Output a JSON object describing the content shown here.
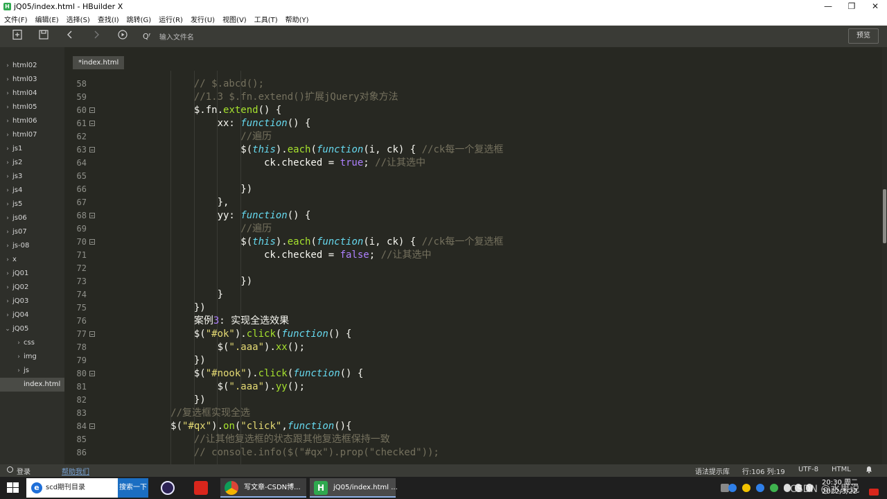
{
  "window": {
    "title": "jQ05/index.html - HBuilder X",
    "app_icon_letter": "H",
    "controls": {
      "minimize": "—",
      "maximize": "❐",
      "close": "✕"
    }
  },
  "menu": [
    "文件(F)",
    "编辑(E)",
    "选择(S)",
    "查找(I)",
    "跳转(G)",
    "运行(R)",
    "发行(U)",
    "视图(V)",
    "工具(T)",
    "帮助(Y)"
  ],
  "toolbar": {
    "new_icon": "new-file-icon",
    "save_icon": "save-icon",
    "back_icon": "back-icon",
    "forward_icon": "forward-icon",
    "run_icon": "run-icon",
    "search_glyph": "Qᶠ",
    "search_placeholder": "输入文件名",
    "preview_label": "预览"
  },
  "sidebar": {
    "items": [
      {
        "label": "html02",
        "arrow": "›"
      },
      {
        "label": "html03",
        "arrow": "›"
      },
      {
        "label": "html04",
        "arrow": "›"
      },
      {
        "label": "html05",
        "arrow": "›"
      },
      {
        "label": "html06",
        "arrow": "›"
      },
      {
        "label": "html07",
        "arrow": "›"
      },
      {
        "label": "js1",
        "arrow": "›"
      },
      {
        "label": "js2",
        "arrow": "›"
      },
      {
        "label": "js3",
        "arrow": "›"
      },
      {
        "label": "js4",
        "arrow": "›"
      },
      {
        "label": "js5",
        "arrow": "›"
      },
      {
        "label": "js06",
        "arrow": "›"
      },
      {
        "label": "js07",
        "arrow": "›"
      },
      {
        "label": "js-08",
        "arrow": "›"
      },
      {
        "label": "x",
        "arrow": "›"
      },
      {
        "label": "jQ01",
        "arrow": "›"
      },
      {
        "label": "jQ02",
        "arrow": "›"
      },
      {
        "label": "jQ03",
        "arrow": "›"
      },
      {
        "label": "jQ04",
        "arrow": "›"
      },
      {
        "label": "jQ05",
        "arrow": "⌄"
      },
      {
        "label": "css",
        "arrow": "›",
        "child": true
      },
      {
        "label": "img",
        "arrow": "›",
        "child": true
      },
      {
        "label": "js",
        "arrow": "›",
        "child": true
      },
      {
        "label": "index.html",
        "arrow": "",
        "child": true,
        "active": true
      }
    ]
  },
  "tab": {
    "label": "*index.html"
  },
  "editor": {
    "lines": [
      {
        "n": "58",
        "fold": false,
        "tokens": [
          [
            "cmt",
            "                // $.abcd();"
          ]
        ]
      },
      {
        "n": "59",
        "fold": false,
        "tokens": [
          [
            "cmt",
            "                //1.3 $.fn.extend()扩展jQuery对象方法"
          ]
        ]
      },
      {
        "n": "60",
        "fold": true,
        "tokens": [
          [
            "def",
            "                $.fn."
          ],
          [
            "fn",
            "extend"
          ],
          [
            "def",
            "() {"
          ]
        ]
      },
      {
        "n": "61",
        "fold": true,
        "tokens": [
          [
            "def",
            "                    xx: "
          ],
          [
            "kw",
            "function"
          ],
          [
            "def",
            "() {"
          ]
        ]
      },
      {
        "n": "62",
        "fold": false,
        "tokens": [
          [
            "cmt",
            "                        //遍历"
          ]
        ]
      },
      {
        "n": "63",
        "fold": true,
        "tokens": [
          [
            "def",
            "                        $("
          ],
          [
            "kw",
            "this"
          ],
          [
            "def",
            ")."
          ],
          [
            "fn",
            "each"
          ],
          [
            "def",
            "("
          ],
          [
            "kw",
            "function"
          ],
          [
            "def",
            "(i, ck) { "
          ],
          [
            "cmt",
            "//ck每一个复选框"
          ]
        ]
      },
      {
        "n": "64",
        "fold": false,
        "tokens": [
          [
            "def",
            "                            ck.checked = "
          ],
          [
            "bool",
            "true"
          ],
          [
            "def",
            "; "
          ],
          [
            "cmt",
            "//让其选中"
          ]
        ]
      },
      {
        "n": "65",
        "fold": false,
        "tokens": [
          [
            "def",
            ""
          ]
        ]
      },
      {
        "n": "66",
        "fold": false,
        "tokens": [
          [
            "def",
            "                        })"
          ]
        ]
      },
      {
        "n": "67",
        "fold": false,
        "tokens": [
          [
            "def",
            "                    },"
          ]
        ]
      },
      {
        "n": "68",
        "fold": true,
        "tokens": [
          [
            "def",
            "                    yy: "
          ],
          [
            "kw",
            "function"
          ],
          [
            "def",
            "() {"
          ]
        ]
      },
      {
        "n": "69",
        "fold": false,
        "tokens": [
          [
            "cmt",
            "                        //遍历"
          ]
        ]
      },
      {
        "n": "70",
        "fold": true,
        "tokens": [
          [
            "def",
            "                        $("
          ],
          [
            "kw",
            "this"
          ],
          [
            "def",
            ")."
          ],
          [
            "fn",
            "each"
          ],
          [
            "def",
            "("
          ],
          [
            "kw",
            "function"
          ],
          [
            "def",
            "(i, ck) { "
          ],
          [
            "cmt",
            "//ck每一个复选框"
          ]
        ]
      },
      {
        "n": "71",
        "fold": false,
        "tokens": [
          [
            "def",
            "                            ck.checked = "
          ],
          [
            "bool",
            "false"
          ],
          [
            "def",
            "; "
          ],
          [
            "cmt",
            "//让其选中"
          ]
        ]
      },
      {
        "n": "72",
        "fold": false,
        "mark": true,
        "tokens": [
          [
            "def",
            ""
          ]
        ]
      },
      {
        "n": "73",
        "fold": false,
        "tokens": [
          [
            "def",
            "                        })"
          ]
        ]
      },
      {
        "n": "74",
        "fold": false,
        "tokens": [
          [
            "def",
            "                    }"
          ]
        ]
      },
      {
        "n": "75",
        "fold": false,
        "tokens": [
          [
            "def",
            "                })"
          ]
        ]
      },
      {
        "n": "76",
        "fold": false,
        "tokens": [
          [
            "def",
            "                案例"
          ],
          [
            "num",
            "3"
          ],
          [
            "def",
            ": 实现全选效果"
          ]
        ]
      },
      {
        "n": "77",
        "fold": true,
        "tokens": [
          [
            "def",
            "                $("
          ],
          [
            "str",
            "\"#ok\""
          ],
          [
            "def",
            ")."
          ],
          [
            "fn",
            "click"
          ],
          [
            "def",
            "("
          ],
          [
            "kw",
            "function"
          ],
          [
            "def",
            "() {"
          ]
        ]
      },
      {
        "n": "78",
        "fold": false,
        "tokens": [
          [
            "def",
            "                    $("
          ],
          [
            "str",
            "\".aaa\""
          ],
          [
            "def",
            ")."
          ],
          [
            "fn",
            "xx"
          ],
          [
            "def",
            "();"
          ]
        ]
      },
      {
        "n": "79",
        "fold": false,
        "tokens": [
          [
            "def",
            "                })"
          ]
        ]
      },
      {
        "n": "80",
        "fold": true,
        "tokens": [
          [
            "def",
            "                $("
          ],
          [
            "str",
            "\"#nook\""
          ],
          [
            "def",
            ")."
          ],
          [
            "fn",
            "click"
          ],
          [
            "def",
            "("
          ],
          [
            "kw",
            "function"
          ],
          [
            "def",
            "() {"
          ]
        ]
      },
      {
        "n": "81",
        "fold": false,
        "tokens": [
          [
            "def",
            "                    $("
          ],
          [
            "str",
            "\".aaa\""
          ],
          [
            "def",
            ")."
          ],
          [
            "fn",
            "yy"
          ],
          [
            "def",
            "();"
          ]
        ]
      },
      {
        "n": "82",
        "fold": false,
        "tokens": [
          [
            "def",
            "                })"
          ]
        ]
      },
      {
        "n": "83",
        "fold": false,
        "tokens": [
          [
            "cmt",
            "            //复选框实现全选"
          ]
        ]
      },
      {
        "n": "84",
        "fold": true,
        "tokens": [
          [
            "def",
            "            $("
          ],
          [
            "str",
            "\"#qx\""
          ],
          [
            "def",
            ")."
          ],
          [
            "fn",
            "on"
          ],
          [
            "def",
            "("
          ],
          [
            "str",
            "\"click\""
          ],
          [
            "def",
            ","
          ],
          [
            "kw",
            "function"
          ],
          [
            "def",
            "(){"
          ]
        ]
      },
      {
        "n": "85",
        "fold": false,
        "tokens": [
          [
            "cmt",
            "                //让其他复选框的状态跟其他复选框保持一致"
          ]
        ]
      },
      {
        "n": "86",
        "fold": false,
        "tokens": [
          [
            "cmt",
            "                // console.info($(\"#qx\").prop(\"checked\"));"
          ]
        ]
      }
    ]
  },
  "status": {
    "login": "登录",
    "help": "帮助我们",
    "hint": "语法提示库",
    "position": "行:106  列:19",
    "encoding": "UTF-8",
    "language": "HTML",
    "bell_icon": "bell-icon"
  },
  "taskbar": {
    "search_text": "scd期刊目录",
    "search_button": "搜索一下",
    "apps": [
      {
        "label": "写文章-CSDN博..."
      },
      {
        "label": "jQ05/index.html ..."
      }
    ],
    "clock_time": "20:30 周二",
    "clock_date": "2022/3/22",
    "watermark": "CSDN @水果说"
  }
}
